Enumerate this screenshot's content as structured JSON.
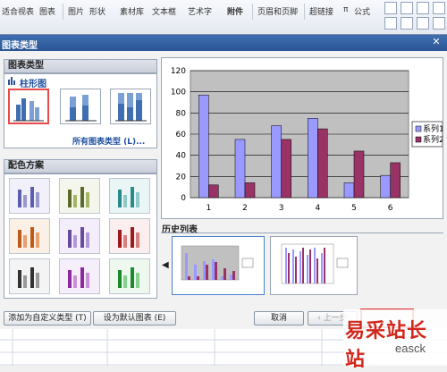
{
  "ribbon": {
    "items": [
      "适合视表",
      "图表",
      "图片",
      "形状",
      "素材库",
      "文本框",
      "艺术字",
      "附件",
      "页眉和页脚",
      "超链接",
      "公式"
    ]
  },
  "dialog": {
    "title": "图表类型",
    "chart_type_header": "图表类型",
    "category_label": "柱形图",
    "all_types_link": "所有图表类型 (L)...",
    "color_scheme_header": "配色方案",
    "history_header": "历史列表",
    "buttons": {
      "add_custom": "添加为自定义类型 (T)",
      "set_default": "设为默认图表 (E)",
      "cancel": "取消",
      "prev": "上一步"
    }
  },
  "watermark": {
    "text": "易采站长站",
    "sub": "easck"
  },
  "chart_data": {
    "type": "bar",
    "categories": [
      "1",
      "2",
      "3",
      "4",
      "5",
      "6"
    ],
    "series": [
      {
        "name": "系列1",
        "values": [
          97,
          55,
          68,
          75,
          14,
          21
        ],
        "color": "#9999ff"
      },
      {
        "name": "系列2",
        "values": [
          12,
          14,
          55,
          65,
          44,
          33
        ],
        "color": "#993366"
      }
    ],
    "yticks": [
      "0",
      "20",
      "40",
      "60",
      "80",
      "100",
      "120"
    ],
    "ylim": [
      0,
      120
    ],
    "legend": "right",
    "grid": true,
    "plot_bg": "#c0c0c0"
  },
  "colors": {
    "accent": "#2a5595",
    "selected": "#e94a4a"
  }
}
